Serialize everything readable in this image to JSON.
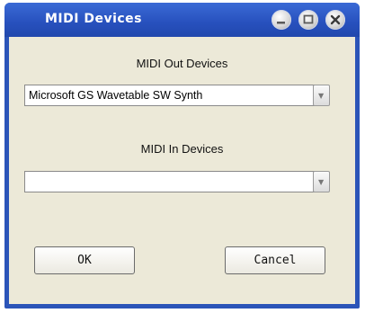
{
  "window": {
    "title": "MIDI Devices"
  },
  "title_buttons": {
    "minimize": "minimize-icon",
    "maximize": "maximize-icon",
    "close": "close-icon"
  },
  "midi_out": {
    "label": "MIDI Out Devices",
    "selected": "Microsoft GS Wavetable SW Synth"
  },
  "midi_in": {
    "label": "MIDI In Devices",
    "selected": ""
  },
  "buttons": {
    "ok": "OK",
    "cancel": "Cancel"
  },
  "colors": {
    "titlebar": "#2750bd",
    "dialog_face": "#ece9d8"
  }
}
